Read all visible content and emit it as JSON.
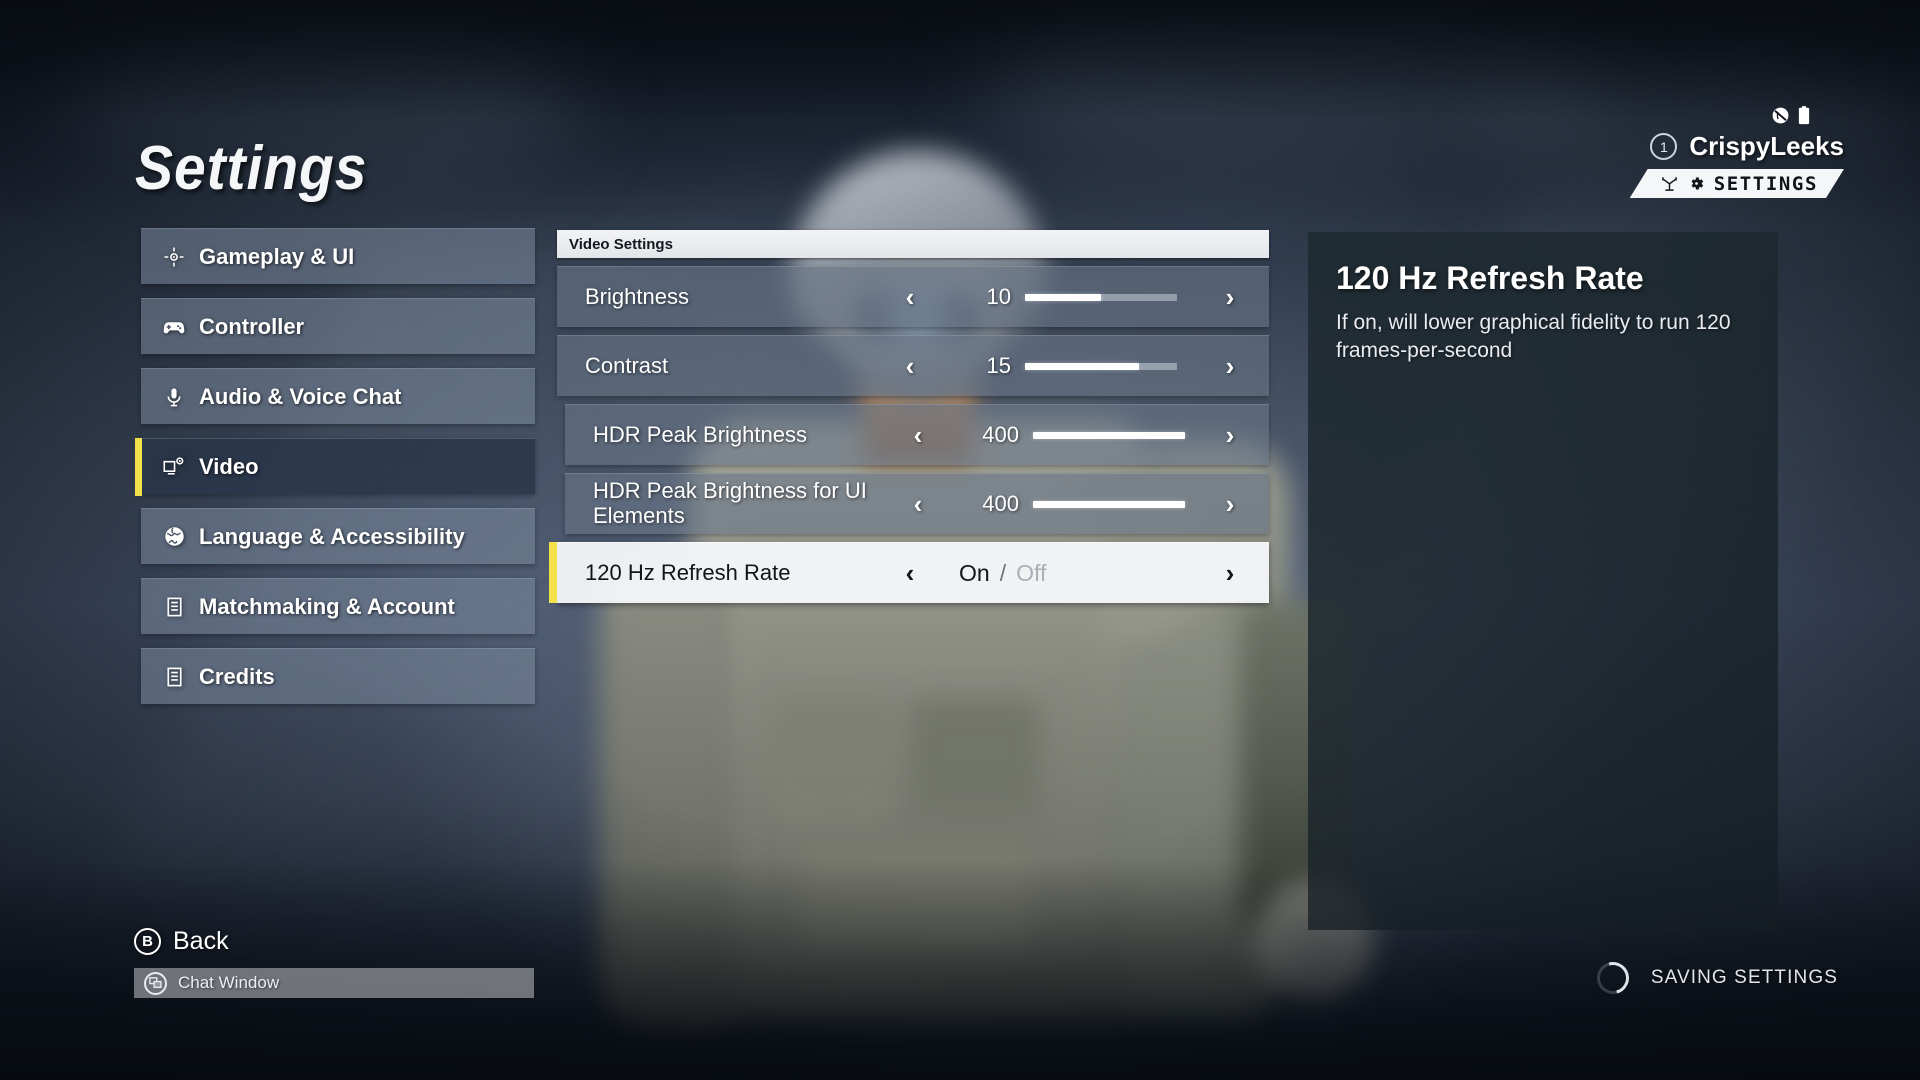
{
  "page": {
    "title": "Settings"
  },
  "sidebar": {
    "items": [
      {
        "label": "Gameplay & UI",
        "icon": "crosshair-icon",
        "active": false
      },
      {
        "label": "Controller",
        "icon": "gamepad-icon",
        "active": false
      },
      {
        "label": "Audio & Voice Chat",
        "icon": "microphone-icon",
        "active": false
      },
      {
        "label": "Video",
        "icon": "display-gear-icon",
        "active": true
      },
      {
        "label": "Language & Accessibility",
        "icon": "globe-icon",
        "active": false
      },
      {
        "label": "Matchmaking & Account",
        "icon": "list-icon",
        "active": false
      },
      {
        "label": "Credits",
        "icon": "list-icon",
        "active": false
      }
    ]
  },
  "panel": {
    "header": "Video Settings",
    "rows": [
      {
        "label": "Brightness",
        "type": "slider",
        "value": "10",
        "fill_percent": 50,
        "selected": false,
        "indented": false
      },
      {
        "label": "Contrast",
        "type": "slider",
        "value": "15",
        "fill_percent": 75,
        "selected": false,
        "indented": false
      },
      {
        "label": "HDR Peak Brightness",
        "type": "slider",
        "value": "400",
        "fill_percent": 100,
        "selected": false,
        "indented": true
      },
      {
        "label": "HDR Peak Brightness for UI Elements",
        "type": "slider",
        "value": "400",
        "fill_percent": 100,
        "selected": false,
        "indented": true
      },
      {
        "label": "120 Hz Refresh Rate",
        "type": "toggle",
        "on_label": "On",
        "separator": "/",
        "off_label": "Off",
        "selected": true,
        "indented": false
      }
    ],
    "chevron_left": "‹",
    "chevron_right": "›"
  },
  "info": {
    "title": "120 Hz Refresh Rate",
    "description": "If on, will lower graphical fidelity to run 120 frames-per-second"
  },
  "account": {
    "name": "CrispyLeeks",
    "badge": "1",
    "banner_label": "SETTINGS",
    "icons": [
      "mute-globe-icon",
      "battery-icon"
    ]
  },
  "footer": {
    "back_button_glyph": "B",
    "back_label": "Back",
    "chat_label": "Chat Window",
    "saving_label": "SAVING SETTINGS"
  },
  "colors": {
    "accent_yellow": "#F2E14A",
    "panel_row": "#68768699",
    "selected_row": "#F7F8FA",
    "info_panel": "#1E2A30"
  }
}
